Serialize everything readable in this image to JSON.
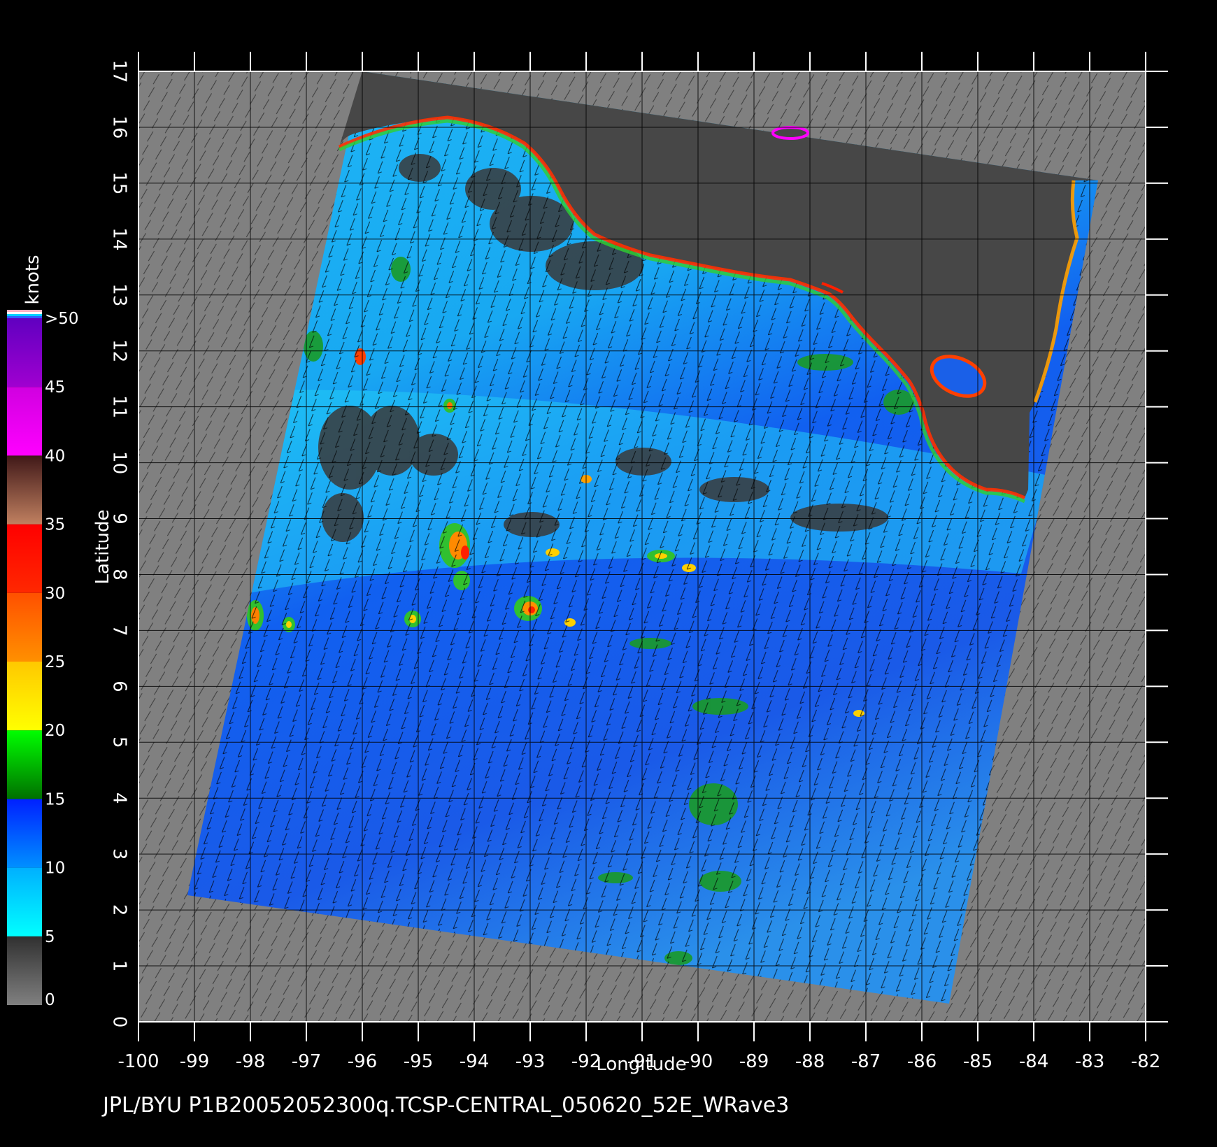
{
  "footer_text": "JPL/BYU  P1B20052052300q.TCSP-CENTRAL_050620_52E_WRave3",
  "axes": {
    "x_label": "Longitude",
    "y_label": "Latitude",
    "x_range": [
      -100,
      -82
    ],
    "y_range": [
      0,
      17
    ],
    "x_ticks": [
      "-100",
      "-99",
      "-98",
      "-97",
      "-96",
      "-95",
      "-94",
      "-93",
      "-92",
      "-91",
      "-90",
      "-89",
      "-88",
      "-87",
      "-86",
      "-85",
      "-84",
      "-83",
      "-82"
    ],
    "y_ticks": [
      "0",
      "1",
      "2",
      "3",
      "4",
      "5",
      "6",
      "7",
      "8",
      "9",
      "10",
      "11",
      "12",
      "13",
      "14",
      "15",
      "16",
      "17"
    ]
  },
  "colorbar": {
    "unit": "knots",
    "labels": [
      "0",
      "5",
      "10",
      "15",
      "20",
      "25",
      "30",
      "35",
      "40",
      "45",
      ">50"
    ],
    "bands": [
      {
        "from": 0,
        "to": 5,
        "colors": [
          "#808080",
          "#303030"
        ]
      },
      {
        "from": 5,
        "to": 10,
        "colors": [
          "#00ffff",
          "#00b0ff"
        ]
      },
      {
        "from": 10,
        "to": 15,
        "colors": [
          "#0090ff",
          "#0020ff"
        ]
      },
      {
        "from": 15,
        "to": 20,
        "colors": [
          "#007000",
          "#00ff00"
        ]
      },
      {
        "from": 20,
        "to": 25,
        "colors": [
          "#ffff00",
          "#ffc800"
        ]
      },
      {
        "from": 25,
        "to": 30,
        "colors": [
          "#ff9000",
          "#ff5000"
        ]
      },
      {
        "from": 30,
        "to": 35,
        "colors": [
          "#ff2800",
          "#ff0000"
        ]
      },
      {
        "from": 35,
        "to": 40,
        "colors": [
          "#c08060",
          "#401818"
        ]
      },
      {
        "from": 40,
        "to": 45,
        "colors": [
          "#ff00ff",
          "#d000e0"
        ]
      },
      {
        "from": 45,
        "to": 50,
        "colors": [
          "#a000d0",
          "#6000c0"
        ]
      }
    ]
  },
  "colors": {
    "background": "#000000",
    "outside_swath": "#808080",
    "land": "#474747",
    "calm_wind": "#3a3a3a"
  }
}
